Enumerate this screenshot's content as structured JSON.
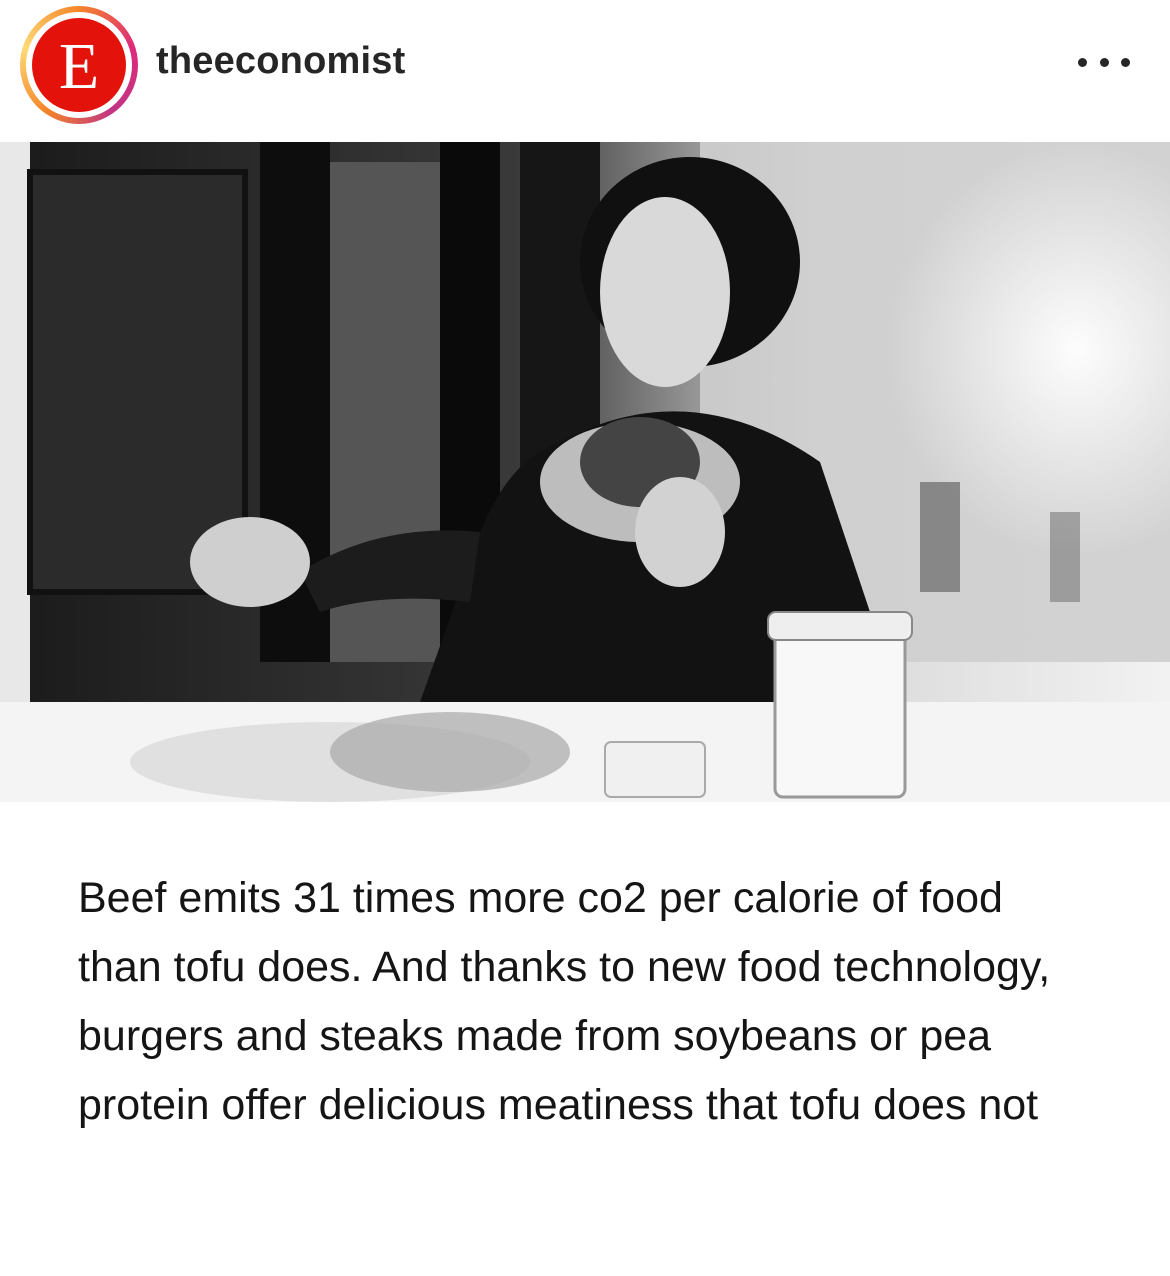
{
  "post": {
    "username": "theeconomist",
    "avatar_letter": "E",
    "more_icon": "more-horizontal-icon",
    "caption": "Beef emits 31 times more co2 per calorie of food than tofu does. And thanks to new food technology, burgers and steaks made from soybeans or pea protein offer delicious meatiness that tofu does not"
  },
  "colors": {
    "brand_red": "#e3120b",
    "story_ring": "#dd2a7b"
  }
}
